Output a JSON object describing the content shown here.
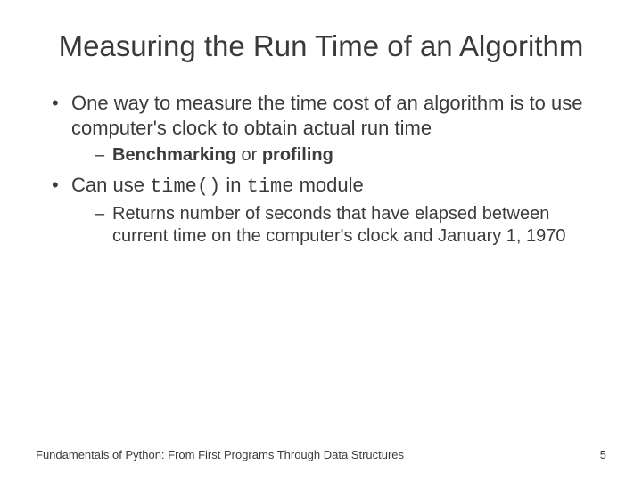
{
  "title": "Measuring the Run Time of an Algorithm",
  "bullets": {
    "b1": {
      "text": "One way to measure the time cost of an algorithm is to use computer's clock to obtain actual run time",
      "sub1_prefix": "",
      "sub1_bold1": "Benchmarking",
      "sub1_mid": " or ",
      "sub1_bold2": "profiling"
    },
    "b2": {
      "prefix": "Can use ",
      "code1": "time()",
      "mid": " in ",
      "code2": "time",
      "suffix": " module",
      "sub1": "Returns number of seconds that have elapsed between current time on the computer's clock and January 1, 1970"
    }
  },
  "footer": {
    "left": "Fundamentals of Python: From First Programs Through Data Structures",
    "right": "5"
  }
}
